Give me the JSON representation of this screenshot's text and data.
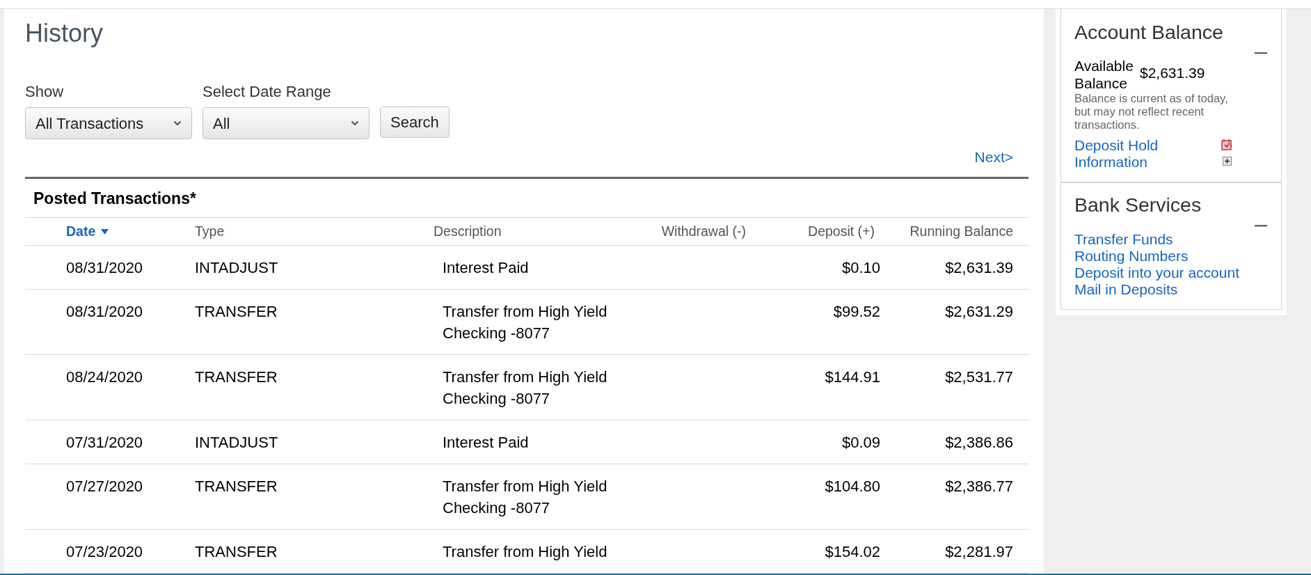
{
  "page": {
    "title": "History"
  },
  "filters": {
    "show": {
      "label": "Show",
      "value": "All Transactions"
    },
    "date_range": {
      "label": "Select Date Range",
      "value": "All"
    },
    "search_button": "Search"
  },
  "pagination": {
    "next": "Next>"
  },
  "table": {
    "title": "Posted Transactions*",
    "columns": [
      {
        "label": "Date",
        "sorted": true
      },
      {
        "label": "Type",
        "sorted": false
      },
      {
        "label": "Description",
        "sorted": false
      },
      {
        "label": "Withdrawal (-)",
        "sorted": false
      },
      {
        "label": "Deposit (+)",
        "sorted": false
      },
      {
        "label": "Running Balance",
        "sorted": false
      }
    ],
    "rows": [
      {
        "date": "08/31/2020",
        "type": "INTADJUST",
        "description": "Interest Paid",
        "deposit": "$0.10",
        "running_balance": "$2,631.39"
      },
      {
        "date": "08/31/2020",
        "type": "TRANSFER",
        "description": "Transfer from High Yield Checking -8077",
        "deposit": "$99.52",
        "running_balance": "$2,631.29"
      },
      {
        "date": "08/24/2020",
        "type": "TRANSFER",
        "description": "Transfer from High Yield Checking -8077",
        "deposit": "$144.91",
        "running_balance": "$2,531.77"
      },
      {
        "date": "07/31/2020",
        "type": "INTADJUST",
        "description": "Interest Paid",
        "deposit": "$0.09",
        "running_balance": "$2,386.86"
      },
      {
        "date": "07/27/2020",
        "type": "TRANSFER",
        "description": "Transfer from High Yield Checking -8077",
        "deposit": "$104.80",
        "running_balance": "$2,386.77"
      },
      {
        "date": "07/23/2020",
        "type": "TRANSFER",
        "description": "Transfer from High Yield",
        "deposit": "$154.02",
        "running_balance": "$2,281.97"
      }
    ]
  },
  "sidebar": {
    "account_balance": {
      "title": "Account Balance",
      "expanded": true,
      "available_label": "Available Balance",
      "amount": "$2,631.39",
      "note": "Balance is current as of today, but may not reflect recent transactions.",
      "deposit_hold_link": "Deposit Hold Information"
    },
    "bank_services": {
      "title": "Bank Services",
      "expanded": true,
      "links": [
        "Transfer Funds",
        "Routing Numbers",
        "Deposit into your account",
        "Mail in Deposits"
      ]
    }
  }
}
